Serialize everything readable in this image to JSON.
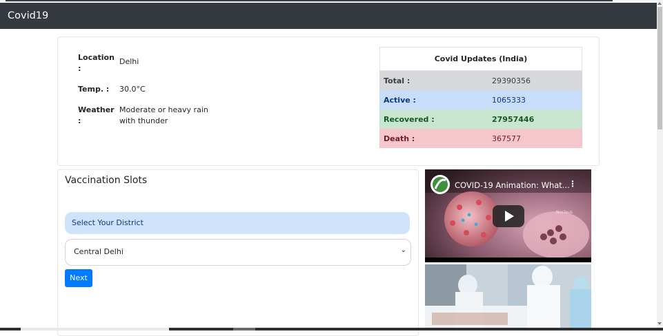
{
  "app": {
    "title": "Covid19"
  },
  "weather": {
    "rows": [
      {
        "label": "Location :",
        "value": "Delhi"
      },
      {
        "label": "Temp. :",
        "value": "30.0°C"
      },
      {
        "label": "Weather :",
        "value": "Moderate or heavy rain with thunder"
      }
    ]
  },
  "updates": {
    "title": "Covid Updates (India)",
    "rows": [
      {
        "label": "Total :",
        "value": "29390356"
      },
      {
        "label": "Active :",
        "value": "1065333"
      },
      {
        "label": "Recovered :",
        "value": "27957446"
      },
      {
        "label": "Death :",
        "value": "367577"
      }
    ]
  },
  "vaccination": {
    "title": "Vaccination Slots",
    "district_label": "Select Your District",
    "district_selected": "Central Delhi",
    "next_label": "Next"
  },
  "video": {
    "title": "COVID-19 Animation: What...",
    "channel_mark": "Nucleus"
  }
}
